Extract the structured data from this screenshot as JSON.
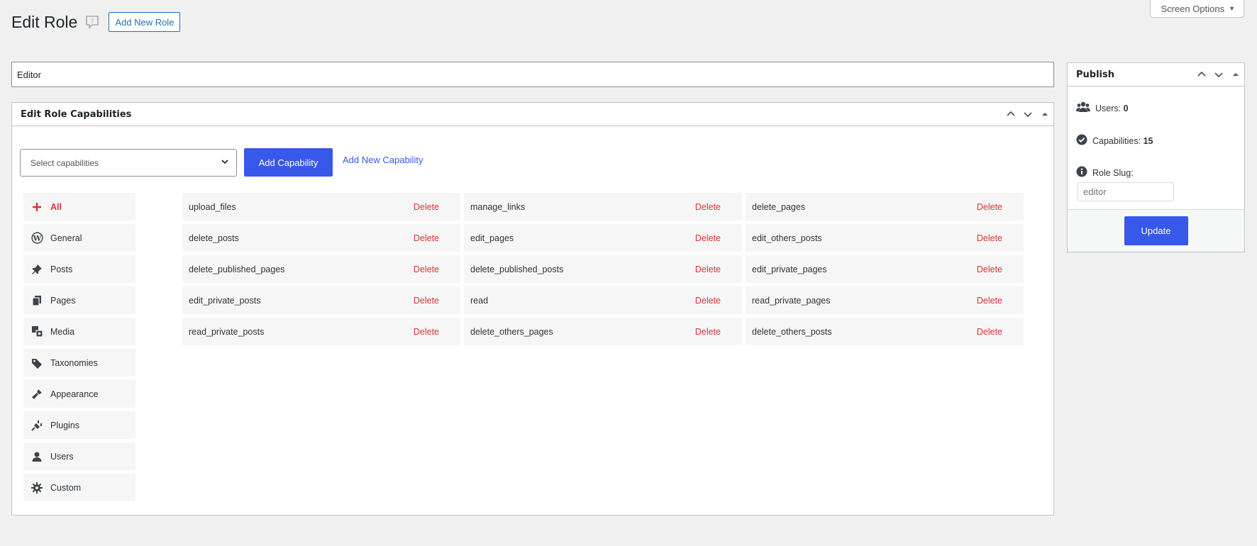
{
  "header": {
    "title": "Edit Role",
    "add_new_role": "Add New Role",
    "screen_options": "Screen Options"
  },
  "role": {
    "name": "Editor"
  },
  "capabilities_box": {
    "title": "Edit Role Capabilities",
    "select_placeholder": "Select capabilities",
    "add_button": "Add Capability",
    "add_new_link": "Add New Capability",
    "groups": [
      {
        "label": "All",
        "icon": "plus-icon"
      },
      {
        "label": "General",
        "icon": "wordpress-icon"
      },
      {
        "label": "Posts",
        "icon": "pushpin-icon"
      },
      {
        "label": "Pages",
        "icon": "pages-icon"
      },
      {
        "label": "Media",
        "icon": "media-icon"
      },
      {
        "label": "Taxonomies",
        "icon": "tag-icon"
      },
      {
        "label": "Appearance",
        "icon": "brush-icon"
      },
      {
        "label": "Plugins",
        "icon": "plug-icon"
      },
      {
        "label": "Users",
        "icon": "user-icon"
      },
      {
        "label": "Custom",
        "icon": "gear-icon"
      }
    ],
    "delete_label": "Delete",
    "capabilities": [
      "upload_files",
      "manage_links",
      "delete_pages",
      "delete_posts",
      "edit_pages",
      "edit_others_posts",
      "delete_published_pages",
      "delete_published_posts",
      "edit_private_pages",
      "edit_private_posts",
      "read",
      "read_private_pages",
      "read_private_posts",
      "delete_others_pages",
      "delete_others_posts"
    ]
  },
  "publish": {
    "title": "Publish",
    "users_label": "Users:",
    "users_count": "0",
    "capabilities_label": "Capabilities:",
    "capabilities_count": "15",
    "role_slug_label": "Role Slug:",
    "role_slug_placeholder": "editor",
    "update_button": "Update"
  },
  "colors": {
    "accent": "#3858e9",
    "delete": "#d63638",
    "background": "#f0f0f1"
  }
}
